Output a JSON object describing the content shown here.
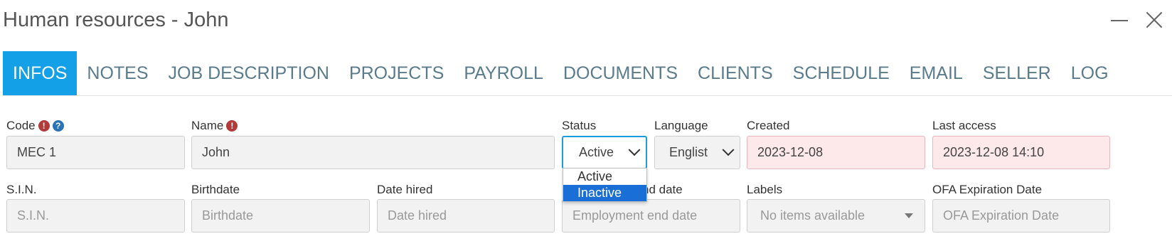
{
  "window": {
    "title": "Human resources - John",
    "minimize_label": "minimize",
    "close_label": "close"
  },
  "tabs": [
    {
      "label": "INFOS",
      "active": true
    },
    {
      "label": "NOTES"
    },
    {
      "label": "JOB DESCRIPTION"
    },
    {
      "label": "PROJECTS"
    },
    {
      "label": "PAYROLL"
    },
    {
      "label": "DOCUMENTS"
    },
    {
      "label": "CLIENTS"
    },
    {
      "label": "SCHEDULE"
    },
    {
      "label": "EMAIL"
    },
    {
      "label": "SELLER"
    },
    {
      "label": "LOG"
    }
  ],
  "icons": {
    "alert": "!",
    "help": "?"
  },
  "row1": {
    "code": {
      "label": "Code",
      "value": "MEC 1"
    },
    "name": {
      "label": "Name",
      "value": "John"
    },
    "status": {
      "label": "Status",
      "value": "Active"
    },
    "language": {
      "label": "Language",
      "value": "Englist"
    },
    "created": {
      "label": "Created",
      "value": "2023-12-08"
    },
    "last_access": {
      "label": "Last access",
      "value": "2023-12-08 14:10"
    }
  },
  "row2": {
    "sin": {
      "label": "S.I.N.",
      "placeholder": "S.I.N."
    },
    "birthdate": {
      "label": "Birthdate",
      "placeholder": "Birthdate"
    },
    "date_hired": {
      "label": "Date hired",
      "placeholder": "Date hired"
    },
    "employment_end": {
      "label_visible": "nd date",
      "placeholder": "Employment end date"
    },
    "labels": {
      "label": "Labels",
      "placeholder": "No items available"
    },
    "ofa": {
      "label": "OFA Expiration Date",
      "placeholder": "OFA Expiration Date"
    }
  },
  "status_dropdown": {
    "options": [
      {
        "label": "Active"
      },
      {
        "label": "Inactive",
        "highlighted": true
      }
    ]
  },
  "colors": {
    "accent": "#14a0e6",
    "tab_text": "#5a7b8c",
    "readonly_pink": "#fde8ea",
    "selected_option": "#1a6fd6",
    "alert": "#b33a3a",
    "help": "#2b73b8"
  }
}
